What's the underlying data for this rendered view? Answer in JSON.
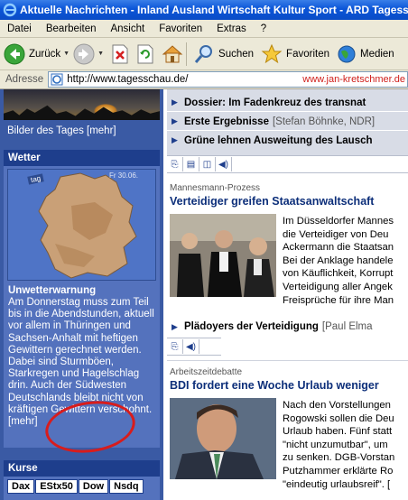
{
  "window": {
    "title": "Aktuelle Nachrichten - Inland Ausland Wirtschaft Kultur Sport - ARD Tagesschau"
  },
  "menu": [
    "Datei",
    "Bearbeiten",
    "Ansicht",
    "Favoriten",
    "Extras",
    "?"
  ],
  "toolbar": {
    "back_label": "Zurück",
    "search_label": "Suchen",
    "favorites_label": "Favoriten",
    "media_label": "Medien"
  },
  "address": {
    "label": "Adresse",
    "url": "http://www.tagesschau.de/",
    "watermark": "www.jan-kretschmer.de"
  },
  "sidebar": {
    "bilder_label": "Bilder des Tages",
    "bilder_more": "[mehr]",
    "wetter_title": "Wetter",
    "map_tag": "tag",
    "map_day": "Fr 30.06.",
    "warning_title": "Unwetterwarnung",
    "warning_text": "Am Donnerstag muss zum Teil bis in die Abendstunden, aktuell vor allem in Thüringen und Sachsen-Anhalt mit heftigen Gewittern gerechnet werden. Dabei sind Sturmböen, Starkregen und Hagelschlag drin. Auch der Südwesten Deutschlands bleibt nicht von kräftigen Gewittern verschohnt.",
    "warning_more": "[mehr]",
    "kurse_title": "Kurse",
    "kurse_tabs": [
      "Dax",
      "EStx50",
      "Dow",
      "Nsdq"
    ],
    "colors": {
      "sidebar": "#3a5aa4",
      "panel_head": "#1e3e8c",
      "annotation_circle": "#d81c1c"
    }
  },
  "main": {
    "teasers": [
      {
        "title": "Dossier: Im Fadenkreuz des transnat",
        "source": ""
      },
      {
        "title": "Erste Ergebnisse",
        "source": "[Stefan Böhnke, NDR]"
      },
      {
        "title": "Grüne lehnen Ausweitung des Lausch",
        "source": ""
      }
    ],
    "article1": {
      "kicker": "Mannesmann-Prozess",
      "headline": "Verteidiger greifen Staatsanwaltschaft",
      "lines": [
        "Im Düsseldorfer Mannes",
        "die Verteidiger von Deu",
        "Ackermann die Staatsan",
        "Bei der Anklage handele",
        "von Käuflichkeit, Korrupt",
        "Verteidigung aller Angek",
        "Freisprüche für ihre Man"
      ],
      "related_title": "Plädoyers der Verteidigung",
      "related_source": "[Paul Elma"
    },
    "article2": {
      "kicker": "Arbeitszeitdebatte",
      "headline": "BDI fordert eine Woche Urlaub weniger",
      "lines": [
        "Nach den Vorstellungen",
        "Rogowski sollen die Deu",
        "Urlaub haben. Fünf statt",
        "\"nicht unzumutbar\", um",
        "zu senken. DGB-Vorstan",
        "Putzhammer erklärte Ro",
        "\"eindeutig urlaubsreif\". ["
      ]
    }
  }
}
